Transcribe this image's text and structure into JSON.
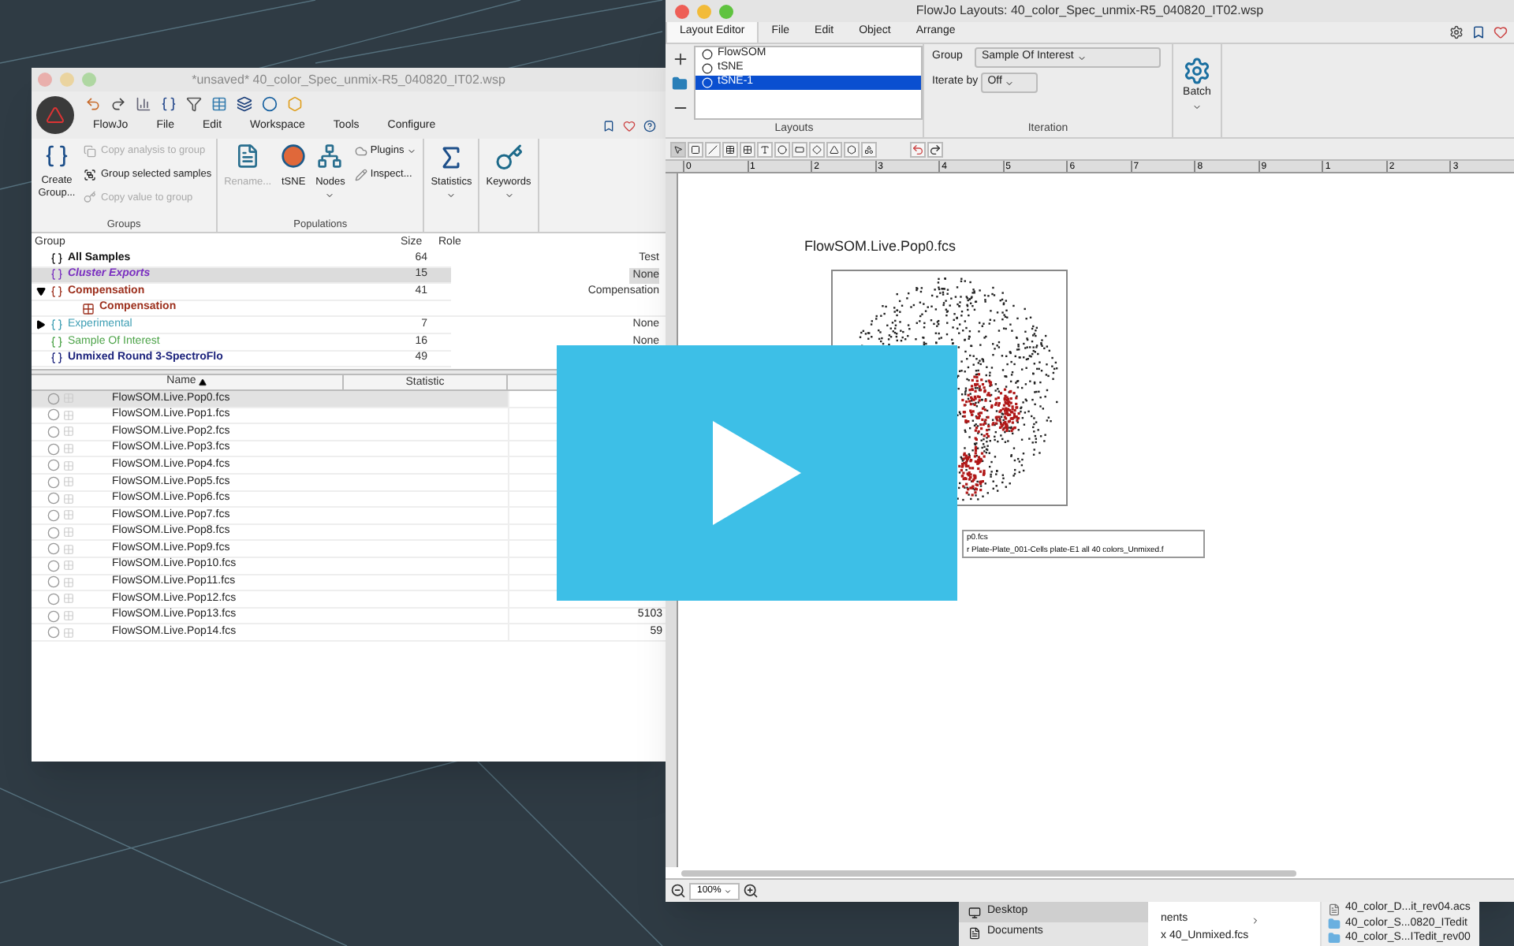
{
  "left_window": {
    "title": "*unsaved* 40_color_Spec_unmix-R5_040820_IT02.wsp",
    "menu": [
      "FlowJo",
      "File",
      "Edit",
      "Workspace",
      "Tools",
      "Configure"
    ],
    "groups_section": {
      "label": "Groups",
      "create": "Create Group...",
      "actions": [
        {
          "label": "Copy analysis to group",
          "disabled": true
        },
        {
          "label": "Group selected samples",
          "disabled": false
        },
        {
          "label": "Copy value to group",
          "disabled": true
        }
      ]
    },
    "populations_section": {
      "label": "Populations",
      "buttons": [
        {
          "label": "Rename...",
          "disabled": true
        },
        {
          "label": "tSNE",
          "disabled": false
        },
        {
          "label": "Nodes",
          "disabled": false
        }
      ],
      "menu": [
        "Plugins",
        "Inspect..."
      ]
    },
    "statistics": "Statistics",
    "keywords": "Keywords",
    "group_table": {
      "columns": [
        "Group",
        "Size",
        "Role"
      ],
      "rows": [
        {
          "name": "All Samples",
          "size": "64",
          "role": "Test",
          "color": "#111111",
          "bold": true,
          "italic": false,
          "selected": false
        },
        {
          "name": "Cluster Exports",
          "size": "15",
          "role": "None",
          "color": "#7a2fc0",
          "bold": true,
          "italic": true,
          "selected": true
        },
        {
          "name": "Compensation",
          "size": "41",
          "role": "Compensation",
          "color": "#9c2f1c",
          "bold": true,
          "italic": false,
          "selected": false,
          "expanded": true,
          "children": [
            {
              "name": "Compensation",
              "color": "#9c2f1c"
            }
          ]
        },
        {
          "name": "Experimental",
          "size": "7",
          "role": "None",
          "color": "#3f9fb4",
          "bold": false,
          "italic": false,
          "selected": false,
          "expanded": false
        },
        {
          "name": "Sample Of Interest",
          "size": "16",
          "role": "None",
          "color": "#4ea44a",
          "bold": false,
          "italic": false,
          "selected": false
        },
        {
          "name": "Unmixed Round 3-SpectroFlo",
          "size": "49",
          "color": "#1c237c",
          "bold": true,
          "italic": false,
          "selected": false
        }
      ]
    },
    "sample_table": {
      "columns": [
        "Name",
        "Statistic"
      ],
      "rows": [
        {
          "name": "FlowSOM.Live.Pop0.fcs",
          "selected": true
        },
        {
          "name": "FlowSOM.Live.Pop1.fcs",
          "selected": false
        },
        {
          "name": "FlowSOM.Live.Pop2.fcs",
          "selected": false
        },
        {
          "name": "FlowSOM.Live.Pop3.fcs",
          "selected": false
        },
        {
          "name": "FlowSOM.Live.Pop4.fcs",
          "selected": false
        },
        {
          "name": "FlowSOM.Live.Pop5.fcs",
          "selected": false
        },
        {
          "name": "FlowSOM.Live.Pop6.fcs",
          "selected": false
        },
        {
          "name": "FlowSOM.Live.Pop7.fcs",
          "selected": false
        },
        {
          "name": "FlowSOM.Live.Pop8.fcs",
          "selected": false
        },
        {
          "name": "FlowSOM.Live.Pop9.fcs",
          "selected": false
        },
        {
          "name": "FlowSOM.Live.Pop10.fcs",
          "selected": false
        },
        {
          "name": "FlowSOM.Live.Pop11.fcs",
          "selected": false
        },
        {
          "name": "FlowSOM.Live.Pop12.fcs",
          "selected": false
        },
        {
          "name": "FlowSOM.Live.Pop13.fcs",
          "count": "5103",
          "selected": false
        },
        {
          "name": "FlowSOM.Live.Pop14.fcs",
          "count": "59",
          "selected": false
        }
      ]
    }
  },
  "right_window": {
    "title": "FlowJo Layouts: 40_color_Spec_unmix-R5_040820_IT02.wsp",
    "tabs": [
      {
        "label": "Layout Editor",
        "selected": true
      },
      {
        "label": "File",
        "selected": false
      },
      {
        "label": "Edit",
        "selected": false
      },
      {
        "label": "Object",
        "selected": false
      },
      {
        "label": "Arrange",
        "selected": false
      }
    ],
    "layouts": {
      "label": "Layouts",
      "items": [
        {
          "name": "FlowSOM",
          "selected": false
        },
        {
          "name": "tSNE",
          "selected": false
        },
        {
          "name": "tSNE-1",
          "selected": true
        }
      ]
    },
    "iteration": {
      "label": "Iteration",
      "group_label": "Group",
      "group_value": "Sample Of Interest",
      "iterate_label": "Iterate by",
      "iterate_value": "Off"
    },
    "batch": "Batch",
    "ruler": [
      "0",
      "1",
      "2",
      "3",
      "4",
      "5",
      "6",
      "7",
      "8",
      "9",
      "1",
      "2",
      "3"
    ],
    "plot_title": "FlowSOM.Live.Pop0.fcs",
    "legend": [
      "p0.fcs",
      "r Plate-Plate_001-Cells plate-E1 all 40 colors_Unmixed.f"
    ],
    "zoom": "100%"
  },
  "finder": {
    "sidebar": [
      {
        "label": "Desktop",
        "selected": true
      },
      {
        "label": "Documents",
        "selected": false
      }
    ],
    "column_2": [
      "nents",
      "x 40_Unmixed.fcs"
    ],
    "column_3": [
      {
        "name": "40_color_D...it_rev04.acs",
        "kind": "file"
      },
      {
        "name": "40_color_S...0820_ITedit",
        "kind": "folder"
      },
      {
        "name": "40_color_S...ITedit_rev00",
        "kind": "folder"
      }
    ]
  }
}
